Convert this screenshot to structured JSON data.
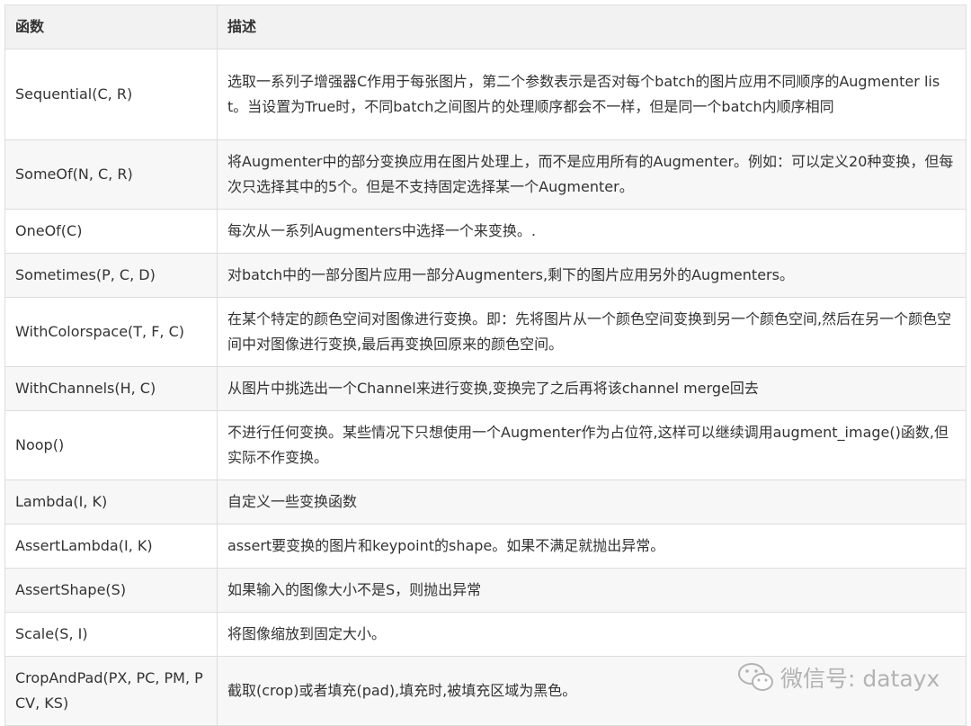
{
  "table": {
    "headers": [
      "函数",
      "描述"
    ],
    "rows": [
      {
        "name": "Sequential(C, R)",
        "desc": "选取一系列子增强器C作用于每张图片，第二个参数表示是否对每个batch的图片应用不同顺序的Augmenter list。当设置为True时，不同batch之间图片的处理顺序都会不一样，但是同一个batch内顺序相同"
      },
      {
        "name": "SomeOf(N, C, R)",
        "desc": "将Augmenter中的部分变换应用在图片处理上，而不是应用所有的Augmenter。例如：可以定义20种变换，但每次只选择其中的5个。但是不支持固定选择某一个Augmenter。"
      },
      {
        "name": "OneOf(C)",
        "desc": "每次从一系列Augmenters中选择一个来变换。."
      },
      {
        "name": "Sometimes(P, C, D)",
        "desc": "对batch中的一部分图片应用一部分Augmenters,剩下的图片应用另外的Augmenters。"
      },
      {
        "name": "WithColorspace(T, F, C)",
        "desc": "在某个特定的颜色空间对图像进行变换。即：先将图片从一个颜色空间变换到另一个颜色空间,然后在另一个颜色空间中对图像进行变换,最后再变换回原来的颜色空间。"
      },
      {
        "name": "WithChannels(H, C)",
        "desc": "从图片中挑选出一个Channel来进行变换,变换完了之后再将该channel merge回去"
      },
      {
        "name": "Noop()",
        "desc": "不进行任何变换。某些情况下只想使用一个Augmenter作为占位符,这样可以继续调用augment_image()函数,但实际不作变换。"
      },
      {
        "name": "Lambda(I, K)",
        "desc": "自定义一些变换函数"
      },
      {
        "name": "AssertLambda(I, K)",
        "desc": "assert要变换的图片和keypoint的shape。如果不满足就抛出异常。"
      },
      {
        "name": "AssertShape(S)",
        "desc": "如果输入的图像大小不是S，则抛出异常"
      },
      {
        "name": "Scale(S, I)",
        "desc": "将图像缩放到固定大小。"
      },
      {
        "name": "CropAndPad(PX, PC, PM, PCV, KS)",
        "desc": "截取(crop)或者填充(pad),填充时,被填充区域为黑色。"
      }
    ]
  },
  "watermark": {
    "text": "微信号: datayx",
    "icon": "wechat-icon"
  }
}
